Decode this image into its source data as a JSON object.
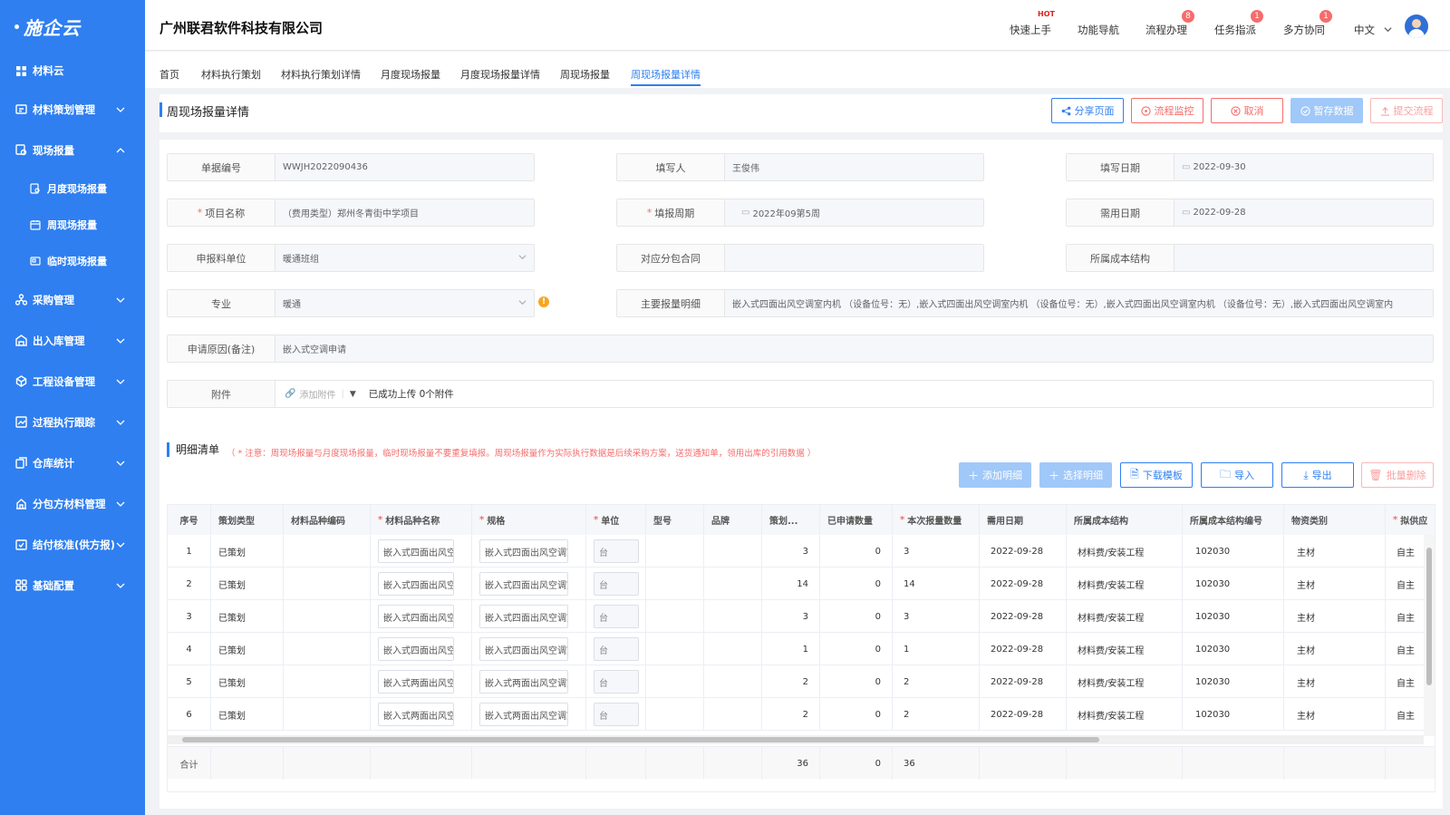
{
  "app": {
    "logo_text": "施企云",
    "company": "广州联君软件科技有限公司"
  },
  "header": {
    "nav": [
      {
        "label": "快速上手",
        "badge": "HOT"
      },
      {
        "label": "功能导航",
        "badge": ""
      },
      {
        "label": "流程办理",
        "badge": "8"
      },
      {
        "label": "任务指派",
        "badge": "1"
      },
      {
        "label": "多方协同",
        "badge": "1"
      }
    ],
    "language": "中文"
  },
  "sidebar": {
    "items": [
      {
        "label": "材料云",
        "icon": "grid-icon"
      },
      {
        "label": "材料策划管理",
        "icon": "plan-icon"
      },
      {
        "label": "现场报量",
        "icon": "report-icon"
      },
      {
        "label": "采购管理",
        "icon": "purchase-icon"
      },
      {
        "label": "出入库管理",
        "icon": "warehouse-icon"
      },
      {
        "label": "工程设备管理",
        "icon": "equipment-icon"
      },
      {
        "label": "过程执行跟踪",
        "icon": "track-icon"
      },
      {
        "label": "仓库统计",
        "icon": "stats-icon"
      },
      {
        "label": "分包方材料管理",
        "icon": "subcontract-icon"
      },
      {
        "label": "结付核准(供方报)",
        "icon": "settle-icon"
      },
      {
        "label": "基础配置",
        "icon": "config-icon"
      }
    ],
    "sub_items": [
      {
        "label": "月度现场报量"
      },
      {
        "label": "周现场报量"
      },
      {
        "label": "临时现场报量"
      }
    ]
  },
  "tabs": [
    "首页",
    "材料执行策划",
    "材料执行策划详情",
    "月度现场报量",
    "月度现场报量详情",
    "周现场报量",
    "周现场报量详情"
  ],
  "page": {
    "title": "周现场报量详情",
    "buttons": {
      "share": "分享页面",
      "monitor": "流程监控",
      "cancel": "取消",
      "save": "暂存数据",
      "submit": "提交流程"
    }
  },
  "form": {
    "doc_no": {
      "label": "单据编号",
      "value": "WWJH2022090436"
    },
    "writer": {
      "label": "填写人",
      "value": "王俊伟"
    },
    "fill_date": {
      "label": "填写日期",
      "value": "2022-09-30"
    },
    "project": {
      "label": "项目名称",
      "value": "（费用类型）郑州冬青街中学项目"
    },
    "period": {
      "label": "填报周期",
      "value": "2022年09第5周"
    },
    "need_date": {
      "label": "需用日期",
      "value": "2022-09-28"
    },
    "unit": {
      "label": "申报料单位",
      "value": "暖通班组"
    },
    "contract": {
      "label": "对应分包合同",
      "value": ""
    },
    "cost": {
      "label": "所属成本结构",
      "value": ""
    },
    "major": {
      "label": "专业",
      "value": "暖通"
    },
    "detail": {
      "label": "主要报量明细",
      "value": "嵌入式四面出风空调室内机 （设备位号：无）,嵌入式四面出风空调室内机 （设备位号：无）,嵌入式四面出风空调室内机 （设备位号：无）,嵌入式四面出风空调室内"
    },
    "reason": {
      "label": "申请原因(备注)",
      "value": "嵌入式空调申请"
    },
    "attach": {
      "label": "附件",
      "add_label": "添加附件",
      "status": "已成功上传 0个附件"
    }
  },
  "detail_list": {
    "title": "明细清单",
    "notice": "（ * 注意：周现场报量与月度现场报量，临时现场报量不要重复填报。周现场报量作为实际执行数据是后续采购方案，送货通知单，领用出库的引用数据 ）",
    "buttons": {
      "add": "添加明细",
      "select": "选择明细",
      "template": "下载模板",
      "import": "导入",
      "export": "导出",
      "delete": "批量删除"
    },
    "columns": [
      "序号",
      "策划类型",
      "材料品种编码",
      "材料品种名称",
      "规格",
      "单位",
      "型号",
      "品牌",
      "策划...",
      "已申请数量",
      "本次报量数量",
      "需用日期",
      "所属成本结构",
      "所属成本结构编号",
      "物资类别",
      "拟供应"
    ],
    "rows": [
      {
        "no": "1",
        "type": "已策划",
        "code": "",
        "name": "嵌入式四面出风空调",
        "spec": "嵌入式四面出风空调室",
        "unit": "台",
        "model": "",
        "brand": "",
        "plan": "3",
        "applied": "0",
        "qty": "3",
        "date": "2022-09-28",
        "cost": "材料费/安装工程",
        "cost_no": "102030",
        "cat": "主材",
        "supply": "自主"
      },
      {
        "no": "2",
        "type": "已策划",
        "code": "",
        "name": "嵌入式四面出风空调",
        "spec": "嵌入式四面出风空调室",
        "unit": "台",
        "model": "",
        "brand": "",
        "plan": "14",
        "applied": "0",
        "qty": "14",
        "date": "2022-09-28",
        "cost": "材料费/安装工程",
        "cost_no": "102030",
        "cat": "主材",
        "supply": "自主"
      },
      {
        "no": "3",
        "type": "已策划",
        "code": "",
        "name": "嵌入式四面出风空调",
        "spec": "嵌入式四面出风空调室",
        "unit": "台",
        "model": "",
        "brand": "",
        "plan": "3",
        "applied": "0",
        "qty": "3",
        "date": "2022-09-28",
        "cost": "材料费/安装工程",
        "cost_no": "102030",
        "cat": "主材",
        "supply": "自主"
      },
      {
        "no": "4",
        "type": "已策划",
        "code": "",
        "name": "嵌入式四面出风空调",
        "spec": "嵌入式四面出风空调室",
        "unit": "台",
        "model": "",
        "brand": "",
        "plan": "1",
        "applied": "0",
        "qty": "1",
        "date": "2022-09-28",
        "cost": "材料费/安装工程",
        "cost_no": "102030",
        "cat": "主材",
        "supply": "自主"
      },
      {
        "no": "5",
        "type": "已策划",
        "code": "",
        "name": "嵌入式两面出风空调",
        "spec": "嵌入式两面出风空调室",
        "unit": "台",
        "model": "",
        "brand": "",
        "plan": "2",
        "applied": "0",
        "qty": "2",
        "date": "2022-09-28",
        "cost": "材料费/安装工程",
        "cost_no": "102030",
        "cat": "主材",
        "supply": "自主"
      },
      {
        "no": "6",
        "type": "已策划",
        "code": "",
        "name": "嵌入式两面出风空调",
        "spec": "嵌入式两面出风空调室",
        "unit": "台",
        "model": "",
        "brand": "",
        "plan": "2",
        "applied": "0",
        "qty": "2",
        "date": "2022-09-28",
        "cost": "材料费/安装工程",
        "cost_no": "102030",
        "cat": "主材",
        "supply": "自主"
      }
    ],
    "total": {
      "label": "合计",
      "plan": "36",
      "applied": "0",
      "qty": "36"
    }
  },
  "colors": {
    "primary": "#2f7ff0",
    "danger": "#f56c6c",
    "sidebar": "#2f7ff0"
  }
}
